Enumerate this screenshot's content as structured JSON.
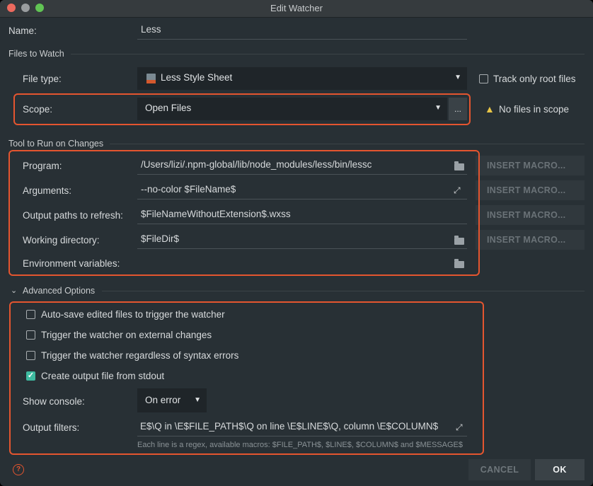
{
  "window": {
    "title": "Edit Watcher"
  },
  "name": {
    "label": "Name:",
    "value": "Less"
  },
  "files_to_watch": {
    "section": "Files to Watch",
    "file_type_label": "File type:",
    "file_type_value": "Less Style Sheet",
    "file_type_icon": "less-file-icon",
    "track_root_label": "Track only root files",
    "scope_label": "Scope:",
    "scope_value": "Open Files",
    "scope_more": "...",
    "scope_warning": "No files in scope"
  },
  "tool": {
    "section": "Tool to Run on Changes",
    "program_label": "Program:",
    "program_value": "/Users/lizi/.npm-global/lib/node_modules/less/bin/lessc",
    "arguments_label": "Arguments:",
    "arguments_value": "--no-color $FileName$",
    "output_label": "Output paths to refresh:",
    "output_value": "$FileNameWithoutExtension$.wxss",
    "workdir_label": "Working directory:",
    "workdir_value": "$FileDir$",
    "env_label": "Environment variables:",
    "env_value": "",
    "insert_macro": "INSERT MACRO..."
  },
  "advanced": {
    "section": "Advanced Options",
    "autosave_label": "Auto-save edited files to trigger the watcher",
    "autosave_checked": false,
    "external_label": "Trigger the watcher on external changes",
    "external_checked": false,
    "syntax_label": "Trigger the watcher regardless of syntax errors",
    "syntax_checked": false,
    "stdout_label": "Create output file from stdout",
    "stdout_checked": true,
    "console_label": "Show console:",
    "console_value": "On error",
    "filters_label": "Output filters:",
    "filters_value": "E$\\Q in \\E$FILE_PATH$\\Q on line \\E$LINE$\\Q, column \\E$COLUMN$",
    "filters_hint": "Each line is a regex, available macros: $FILE_PATH$, $LINE$, $COLUMN$ and $MESSAGE$"
  },
  "footer": {
    "cancel": "CANCEL",
    "ok": "OK"
  },
  "colors": {
    "accent": "#3ebaa0",
    "highlight": "#e4552f",
    "warning": "#e8c547",
    "background": "#283035"
  }
}
